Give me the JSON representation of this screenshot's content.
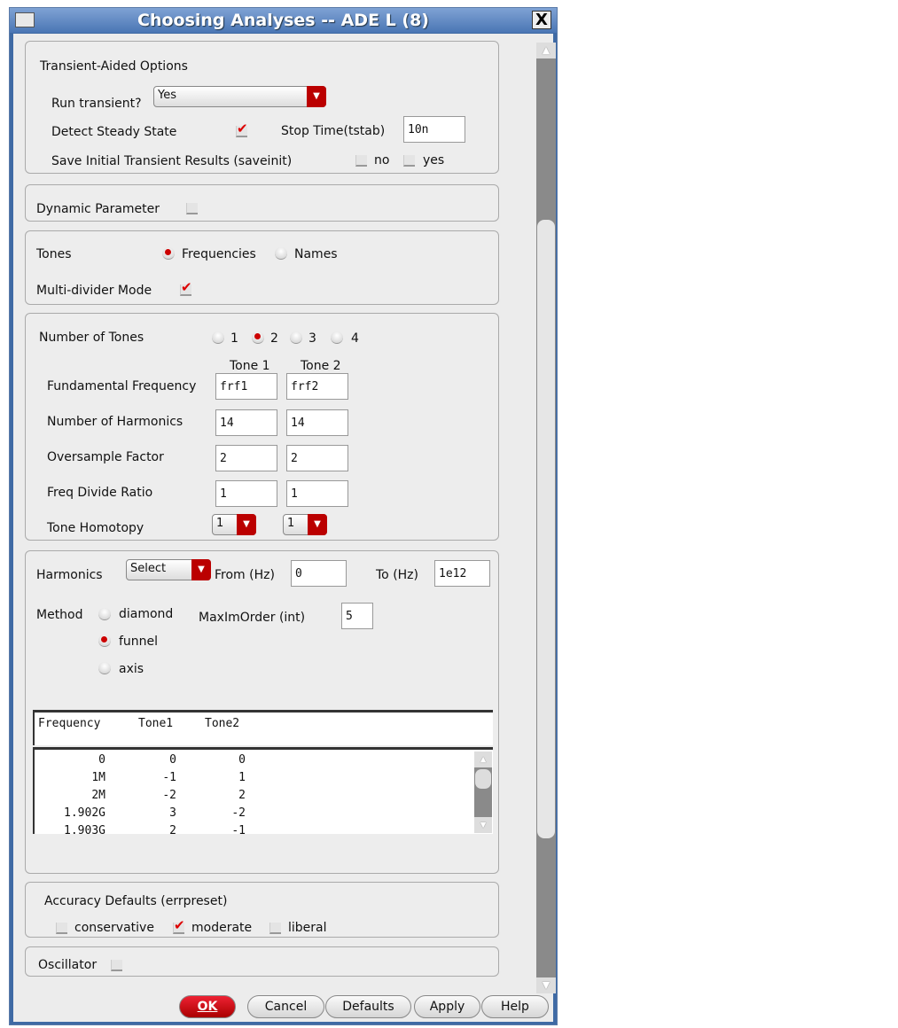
{
  "window": {
    "title": "Choosing Analyses -- ADE L (8)",
    "close": "X"
  },
  "transient": {
    "heading": "Transient-Aided Options",
    "run_label": "Run transient?",
    "run_value": "Yes",
    "detect_label": "Detect Steady State",
    "detect_checked": true,
    "stop_label": "Stop Time(tstab)",
    "stop_value": "10n",
    "saveinit_label": "Save Initial Transient Results (saveinit)",
    "no": "no",
    "yes": "yes"
  },
  "dynamic": {
    "label": "Dynamic Parameter",
    "checked": false
  },
  "tones_mode": {
    "label": "Tones",
    "frequencies": "Frequencies",
    "names": "Names",
    "selected": "Frequencies",
    "multidiv_label": "Multi-divider Mode",
    "multidiv_checked": true
  },
  "tones": {
    "label": "Number of Tones",
    "options": [
      "1",
      "2",
      "3",
      "4"
    ],
    "selected": "2",
    "col1": "Tone 1",
    "col2": "Tone 2",
    "rows": [
      {
        "label": "Fundamental Frequency",
        "t1": "frf1",
        "t2": "frf2"
      },
      {
        "label": "Number of Harmonics",
        "t1": "14",
        "t2": "14"
      },
      {
        "label": "Oversample Factor",
        "t1": "2",
        "t2": "2"
      },
      {
        "label": "Freq Divide Ratio",
        "t1": "1",
        "t2": "1"
      }
    ],
    "homotopy_label": "Tone Homotopy",
    "homotopy1": "1",
    "homotopy2": "1"
  },
  "harmonics": {
    "label": "Harmonics",
    "select": "Select",
    "from_label": "From (Hz)",
    "from": "0",
    "to_label": "To (Hz)",
    "to": "1e12",
    "method_label": "Method",
    "methods": [
      "diamond",
      "funnel",
      "axis"
    ],
    "method_selected": "funnel",
    "maxorder_label": "MaxImOrder (int)",
    "maxorder": "5",
    "table_headers": [
      "Frequency",
      "Tone1",
      "Tone2"
    ],
    "table_rows": [
      [
        "0",
        "0",
        "0"
      ],
      [
        "1M",
        "-1",
        "1"
      ],
      [
        "2M",
        "-2",
        "2"
      ],
      [
        "1.902G",
        "3",
        "-2"
      ],
      [
        "1.903G",
        "2",
        "-1"
      ]
    ]
  },
  "accuracy": {
    "label": "Accuracy Defaults (errpreset)",
    "options": [
      "conservative",
      "moderate",
      "liberal"
    ],
    "selected": "moderate"
  },
  "oscillator": {
    "label": "Oscillator",
    "checked": false
  },
  "buttons": {
    "ok": "OK",
    "cancel": "Cancel",
    "defaults": "Defaults",
    "apply": "Apply",
    "help": "Help"
  }
}
